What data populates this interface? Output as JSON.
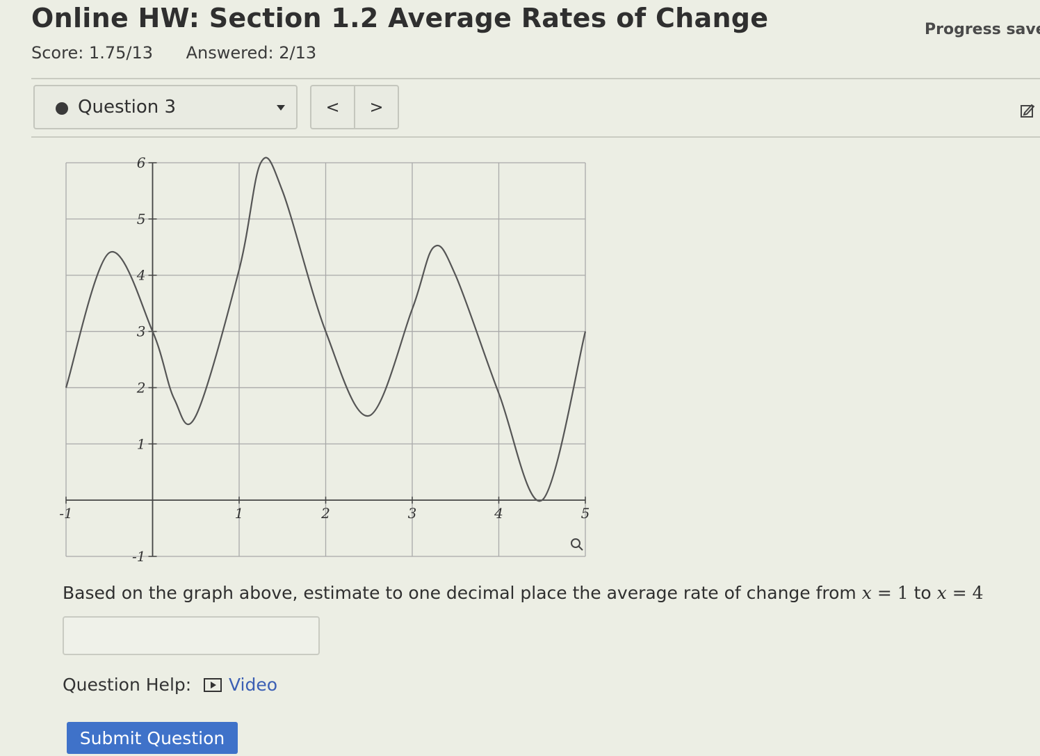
{
  "header": {
    "title": "Online HW: Section 1.2 Average Rates of Change",
    "progress": "Progress save",
    "score": "Score: 1.75/13",
    "answered": "Answered: 2/13"
  },
  "question_nav": {
    "selected": "Question 3",
    "prev": "<",
    "next": ">"
  },
  "prompt": {
    "text": "Based on the graph above, estimate to one decimal place the average rate of change from",
    "var": "x",
    "eq": "=",
    "start": "1",
    "to": "to",
    "end": "4"
  },
  "answer": {
    "value": ""
  },
  "help": {
    "label": "Question Help:",
    "video": "Video"
  },
  "submit": {
    "label": "Submit Question"
  },
  "chart_data": {
    "type": "line",
    "xlim": [
      -1,
      5
    ],
    "ylim": [
      -1,
      6
    ],
    "x_ticks": [
      "-1",
      "1",
      "2",
      "3",
      "4",
      "5"
    ],
    "y_ticks": [
      "-1",
      "1",
      "2",
      "3",
      "4",
      "5",
      "6"
    ],
    "grid": true,
    "x": [
      -1,
      -0.5,
      0,
      0.25,
      0.5,
      1,
      1.25,
      1.5,
      2,
      2.5,
      3,
      3.25,
      3.5,
      4,
      4.5,
      5
    ],
    "y": [
      2.0,
      4.4,
      3.0,
      1.8,
      1.5,
      4.1,
      6.0,
      5.5,
      3.0,
      1.5,
      3.4,
      4.5,
      4.0,
      1.9,
      0.0,
      3.0
    ],
    "line_color": "#555555"
  }
}
